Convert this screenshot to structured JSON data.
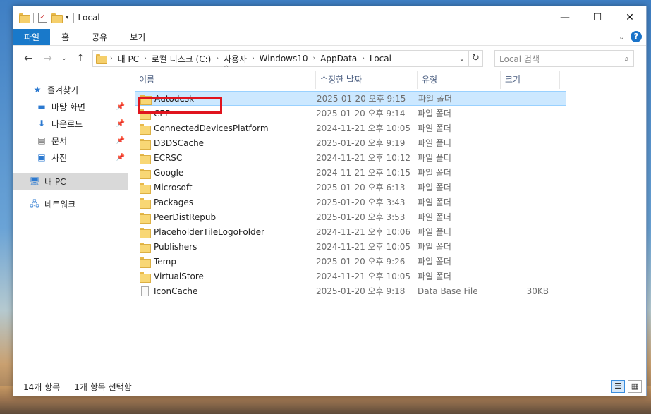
{
  "window": {
    "title": "Local"
  },
  "ribbon": {
    "tabs": [
      "파일",
      "홈",
      "공유",
      "보기"
    ]
  },
  "address": {
    "crumbs": [
      "내 PC",
      "로컬 디스크 (C:)",
      "사용자",
      "Windows10",
      "AppData",
      "Local"
    ]
  },
  "search": {
    "placeholder": "Local 검색"
  },
  "nav": {
    "quick_access": "즐겨찾기",
    "items": [
      {
        "label": "바탕 화면",
        "icon": "desktop-icon"
      },
      {
        "label": "다운로드",
        "icon": "download-icon"
      },
      {
        "label": "문서",
        "icon": "document-icon"
      },
      {
        "label": "사진",
        "icon": "pictures-icon"
      }
    ],
    "this_pc": "내 PC",
    "network": "네트워크"
  },
  "columns": {
    "name": "이름",
    "date": "수정한 날짜",
    "type": "유형",
    "size": "크기"
  },
  "files": [
    {
      "name": "Autodesk",
      "date": "2025-01-20 오후 9:15",
      "type": "파일 폴더",
      "size": "",
      "kind": "folder"
    },
    {
      "name": "CEF",
      "date": "2025-01-20 오후 9:14",
      "type": "파일 폴더",
      "size": "",
      "kind": "folder"
    },
    {
      "name": "ConnectedDevicesPlatform",
      "date": "2024-11-21 오후 10:05",
      "type": "파일 폴더",
      "size": "",
      "kind": "folder"
    },
    {
      "name": "D3DSCache",
      "date": "2025-01-20 오후 9:19",
      "type": "파일 폴더",
      "size": "",
      "kind": "folder"
    },
    {
      "name": "ECRSC",
      "date": "2024-11-21 오후 10:12",
      "type": "파일 폴더",
      "size": "",
      "kind": "folder"
    },
    {
      "name": "Google",
      "date": "2024-11-21 오후 10:15",
      "type": "파일 폴더",
      "size": "",
      "kind": "folder"
    },
    {
      "name": "Microsoft",
      "date": "2025-01-20 오후 6:13",
      "type": "파일 폴더",
      "size": "",
      "kind": "folder"
    },
    {
      "name": "Packages",
      "date": "2025-01-20 오후 3:43",
      "type": "파일 폴더",
      "size": "",
      "kind": "folder"
    },
    {
      "name": "PeerDistRepub",
      "date": "2025-01-20 오후 3:53",
      "type": "파일 폴더",
      "size": "",
      "kind": "folder"
    },
    {
      "name": "PlaceholderTileLogoFolder",
      "date": "2024-11-21 오후 10:06",
      "type": "파일 폴더",
      "size": "",
      "kind": "folder"
    },
    {
      "name": "Publishers",
      "date": "2024-11-21 오후 10:05",
      "type": "파일 폴더",
      "size": "",
      "kind": "folder"
    },
    {
      "name": "Temp",
      "date": "2025-01-20 오후 9:26",
      "type": "파일 폴더",
      "size": "",
      "kind": "folder"
    },
    {
      "name": "VirtualStore",
      "date": "2024-11-21 오후 10:05",
      "type": "파일 폴더",
      "size": "",
      "kind": "folder"
    },
    {
      "name": "IconCache",
      "date": "2025-01-20 오후 9:18",
      "type": "Data Base File",
      "size": "30KB",
      "kind": "file"
    }
  ],
  "selected_index": 0,
  "status": {
    "count": "14개 항목",
    "selected": "1개 항목 선택함"
  },
  "colors": {
    "accent": "#1979ca",
    "selection": "#cce8ff",
    "highlight": "#e0141e"
  }
}
